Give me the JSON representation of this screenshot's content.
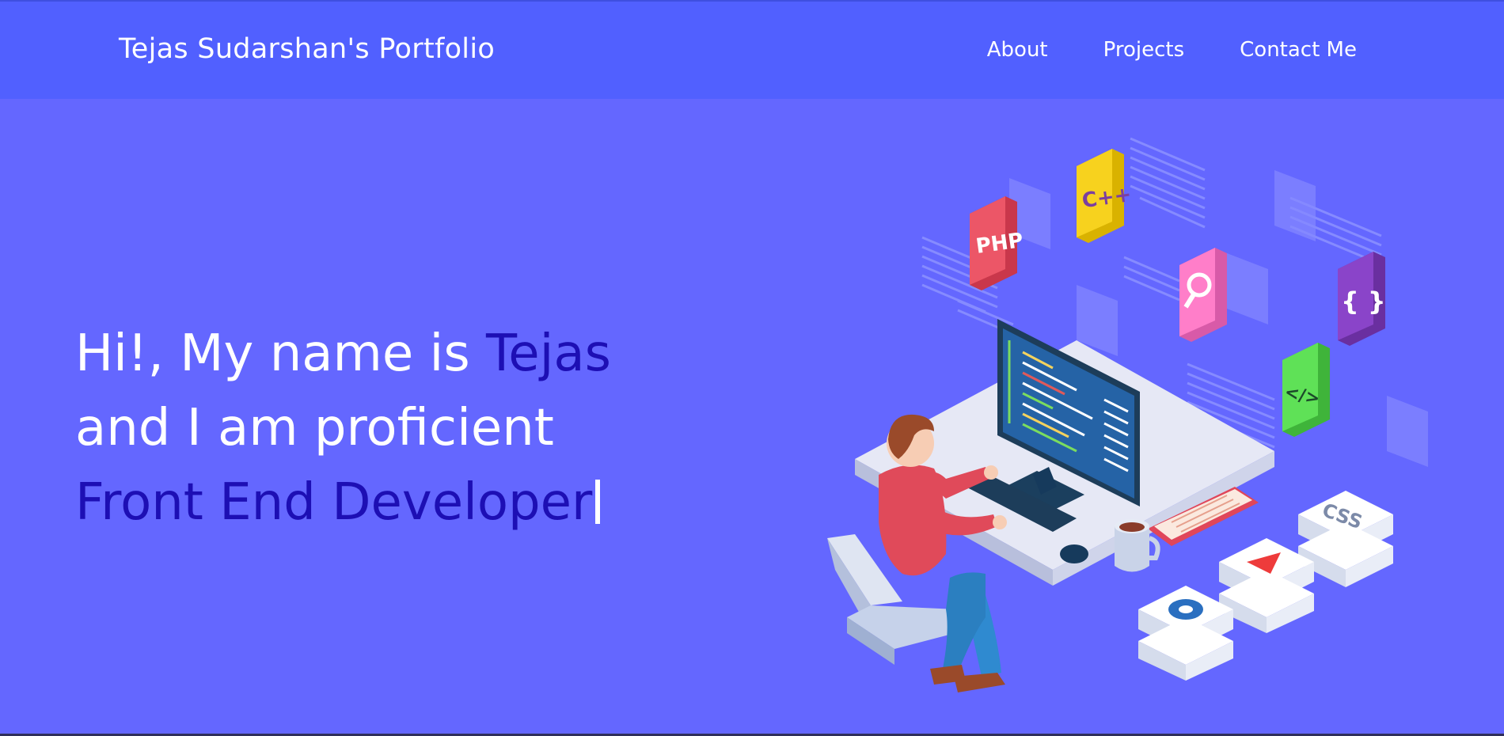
{
  "navbar": {
    "brand": "Tejas Sudarshan's Portfolio",
    "links": [
      "About",
      "Projects",
      "Contact Me"
    ]
  },
  "hero": {
    "line1_prefix": "Hi!, My name is ",
    "line1_name": "Tejas",
    "line2": "and I am proficient",
    "line3_role": "Front End Developer"
  },
  "illustration": {
    "labels": {
      "php": "PHP",
      "cpp": "C++",
      "braces": "{ }",
      "code": "</>",
      "css": "CSS"
    },
    "icons": [
      "php-tile-icon",
      "cpp-tile-icon",
      "search-tile-icon",
      "braces-tile-icon",
      "code-tile-icon",
      "css-tile-icon",
      "play-tile-icon",
      "gear-tile-icon"
    ]
  },
  "colors": {
    "navbar_bg": "#5160ff",
    "page_bg": "#6467ff",
    "accent_text": "#1d0fb4",
    "text": "#ffffff"
  }
}
